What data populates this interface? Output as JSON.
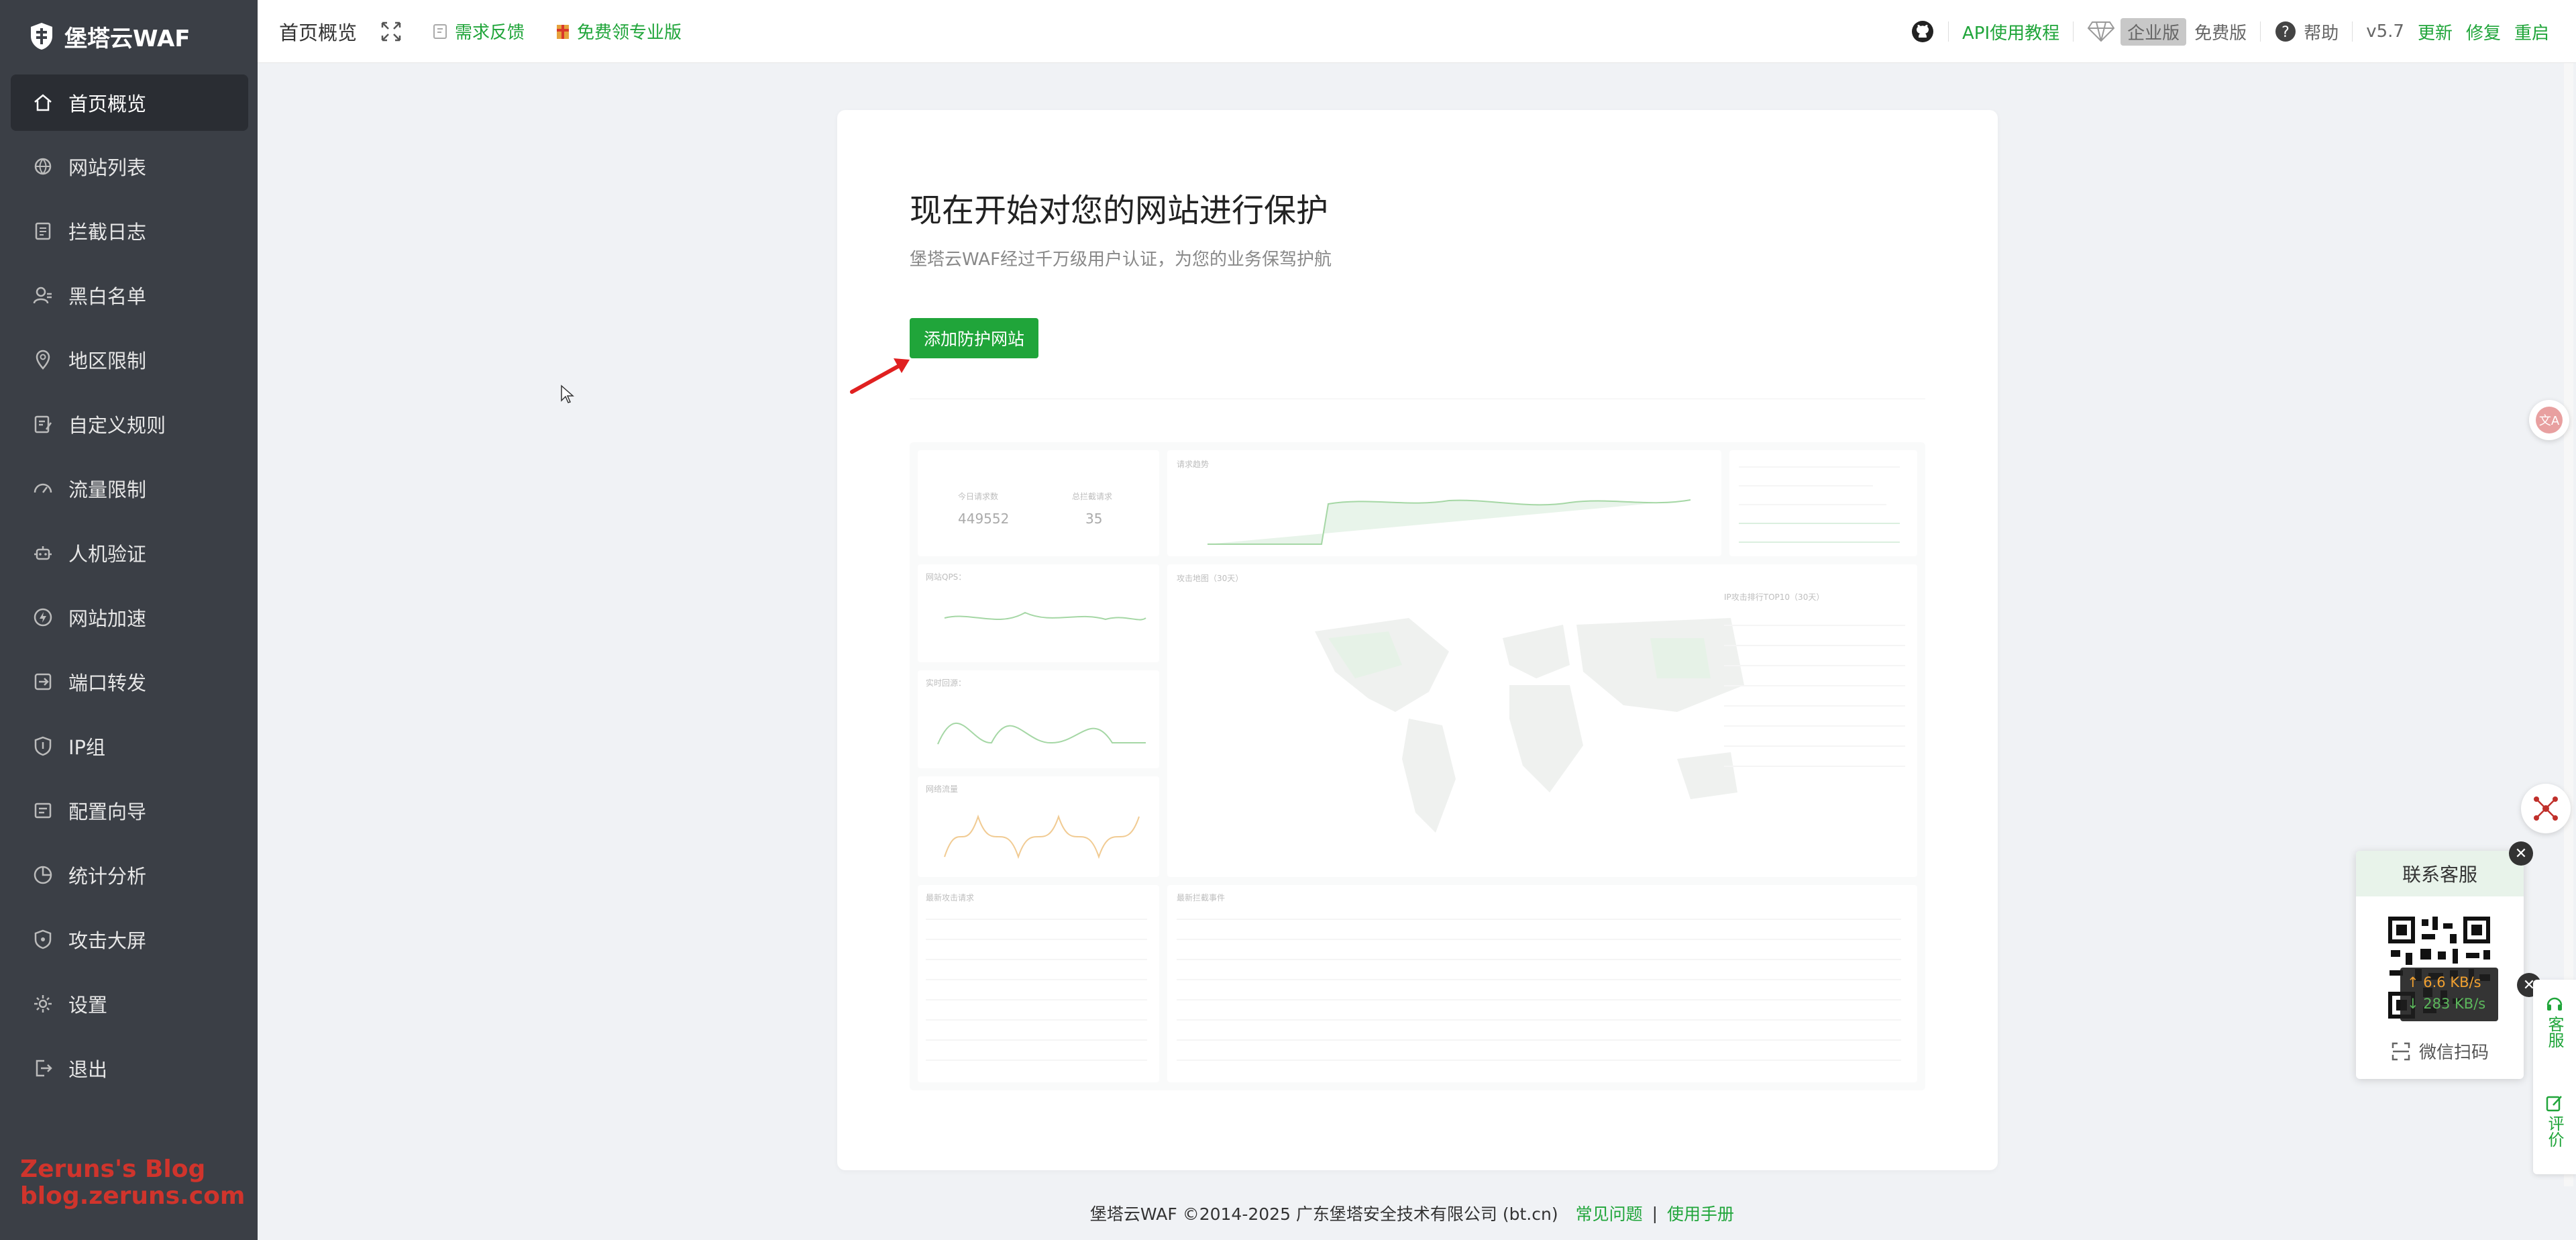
{
  "brand": {
    "name": "堡塔云WAF"
  },
  "sidebar": {
    "items": [
      {
        "label": "首页概览",
        "icon": "home-icon",
        "active": true
      },
      {
        "label": "网站列表",
        "icon": "globe-icon"
      },
      {
        "label": "拦截日志",
        "icon": "log-icon"
      },
      {
        "label": "黑白名单",
        "icon": "user-list-icon"
      },
      {
        "label": "地区限制",
        "icon": "location-icon"
      },
      {
        "label": "自定义规则",
        "icon": "rule-edit-icon"
      },
      {
        "label": "流量限制",
        "icon": "gauge-icon"
      },
      {
        "label": "人机验证",
        "icon": "robot-icon"
      },
      {
        "label": "网站加速",
        "icon": "bolt-icon"
      },
      {
        "label": "端口转发",
        "icon": "forward-icon"
      },
      {
        "label": "IP组",
        "icon": "shield-icon"
      },
      {
        "label": "配置向导",
        "icon": "wizard-icon"
      },
      {
        "label": "统计分析",
        "icon": "pie-chart-icon"
      },
      {
        "label": "攻击大屏",
        "icon": "shield-alert-icon"
      },
      {
        "label": "设置",
        "icon": "gear-icon"
      },
      {
        "label": "退出",
        "icon": "logout-icon"
      }
    ],
    "watermark": [
      "Zeruns's Blog",
      "blog.zeruns.com"
    ]
  },
  "topbar": {
    "title": "首页概览",
    "feedback": "需求反馈",
    "free_pro": "免费领专业版",
    "api_tutorial": "API使用教程",
    "enterprise": "企业版",
    "free_edition": "免费版",
    "help": "帮助",
    "version": "v5.7",
    "update": "更新",
    "repair": "修复",
    "restart": "重启"
  },
  "main": {
    "heading": "现在开始对您的网站进行保护",
    "subtitle": "堡塔云WAF经过千万级用户认证，为您的业务保驾护航",
    "add_button": "添加防护网站"
  },
  "preview": {
    "today_requests_label": "今日请求数",
    "today_requests": "449552",
    "today_blocked_label": "总拦截请求",
    "today_blocked": "35",
    "trend_title": "请求趋势",
    "qps_title": "网站QPS：",
    "response_title": "实时回源：",
    "traffic_title": "网络流量",
    "map_title": "攻击地图（30天）",
    "top_title": "IP攻击排行TOP10（30天）",
    "recent_requests_title": "最新攻击请求",
    "block_events_title": "最新拦截事件"
  },
  "service": {
    "title": "联系客服",
    "scan": "微信扫码",
    "speed_up": "↑ 6.6 KB/s",
    "speed_down": "↓ 283 KB/s",
    "tab_service": "客服",
    "tab_review": "评价"
  },
  "footer": {
    "copyright": "堡塔云WAF ©2014-2025 广东堡塔安全技术有限公司 (bt.cn)",
    "faq": "常见问题",
    "sep": "|",
    "manual": "使用手册"
  },
  "colors": {
    "accent": "#20a53a",
    "sidebar": "#3b3f46"
  }
}
